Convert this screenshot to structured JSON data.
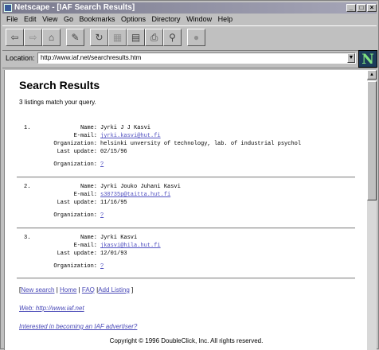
{
  "window": {
    "title": "Netscape - [IAF Search Results]"
  },
  "menu": [
    "File",
    "Edit",
    "View",
    "Go",
    "Bookmarks",
    "Options",
    "Directory",
    "Window",
    "Help"
  ],
  "location": {
    "label": "Location:",
    "url": "http://www.iaf.net/searchresults.htm"
  },
  "page": {
    "heading": "Search Results",
    "summary": "3 listings match your query.",
    "labels": {
      "name": "Name:",
      "email": "E-mail:",
      "org": "Organization:",
      "last_update": "Last update:"
    },
    "results": [
      {
        "index": "1.",
        "name": "Jyrki J J Kasvi",
        "email": "jyrki.kasvi@hut.fi",
        "organization": "helsinki unversity of technology, lab. of industrial psychol",
        "last_update": "02/15/96",
        "org_link": "?"
      },
      {
        "index": "2.",
        "name": "Jyrki Jouko Juhani Kasvi",
        "email": "s30735p@taitta.hut.fi",
        "last_update": "11/16/95",
        "org_link": "?"
      },
      {
        "index": "3.",
        "name": "Jyrki Kasvi",
        "email": "jkasvi@hila.hut.fi",
        "last_update": "12/01/93",
        "org_link": "?"
      }
    ],
    "nav": {
      "open": "[",
      "new_search": "New search",
      "sep1": " | ",
      "home": "Home",
      "sep2": " | ",
      "faq": "FAQ",
      "sep3": " |",
      "add_listing": "Add Listing",
      "close": " ]"
    },
    "web_link": "Web: http://www.iaf.net",
    "advertiser_link": "Interested in becoming an IAF advertiser?",
    "copyright": "Copyright © 1996 DoubleClick, Inc. All rights reserved."
  }
}
